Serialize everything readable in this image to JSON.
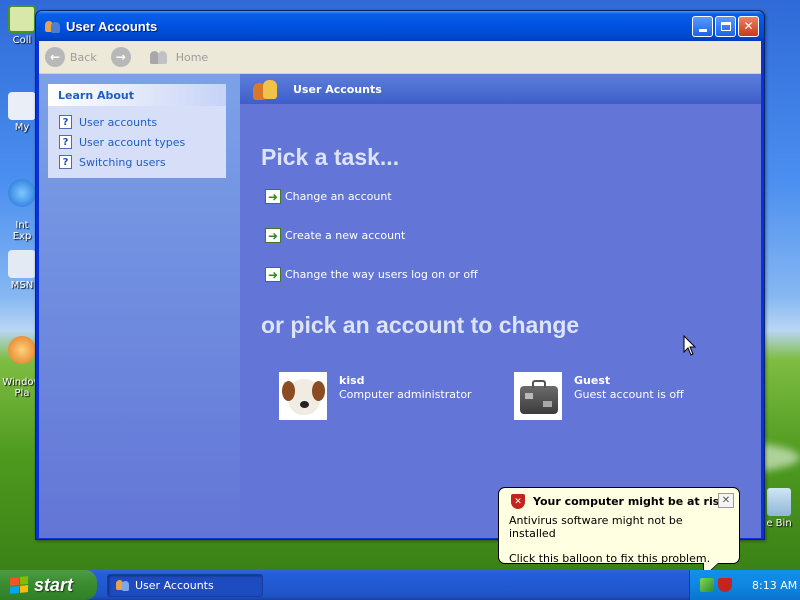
{
  "desktop": {
    "icons": [
      "Coll",
      "My",
      "Int\nExp",
      "MSN",
      "Window\nPla"
    ],
    "recycle_label": "e Bin"
  },
  "window": {
    "title": "User Accounts"
  },
  "toolbar": {
    "back_label": "Back",
    "home_label": "Home"
  },
  "left_panel": {
    "heading": "Learn About",
    "items": [
      {
        "label": "User accounts",
        "icon": "help-icon"
      },
      {
        "label": "User account types",
        "icon": "help-icon"
      },
      {
        "label": "Switching users",
        "icon": "help-icon"
      }
    ]
  },
  "main": {
    "header": "User Accounts",
    "pick_task": "Pick a task...",
    "tasks": [
      "Change an account",
      "Create a new account",
      "Change the way users log on or off"
    ],
    "pick_account": "or pick an account to change",
    "accounts": [
      {
        "name": "kisd",
        "subtitle": "Computer administrator",
        "icon": "dog-avatar"
      },
      {
        "name": "Guest",
        "subtitle": "Guest account is off",
        "icon": "briefcase-avatar"
      }
    ]
  },
  "balloon": {
    "title": "Your computer might be at risk",
    "line1": "Antivirus software might not be installed",
    "line2": "Click this balloon to fix this problem."
  },
  "taskbar": {
    "start_label": "start",
    "active_task": "User Accounts",
    "clock": "8:13 AM"
  },
  "colors": {
    "main_bg": "#6375d6",
    "title_bar": "#0054e3",
    "link": "#215dc6",
    "start_green": "#3c8e32",
    "taskbar_blue": "#245edb"
  }
}
